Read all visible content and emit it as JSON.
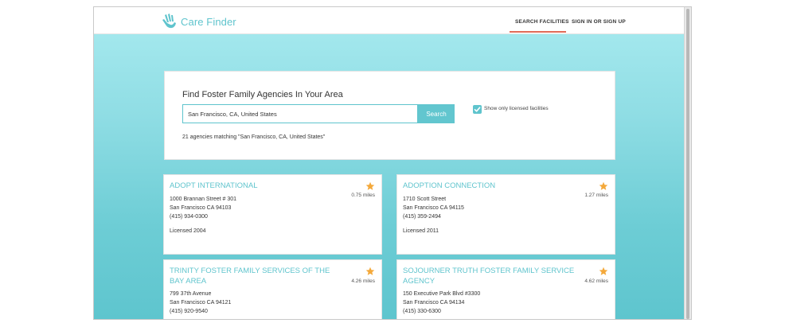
{
  "header": {
    "brand": "Care Finder",
    "nav": {
      "search_facilities": "SEARCH FACILITIES",
      "sign_in": "SIGN IN OR SIGN UP"
    }
  },
  "search": {
    "title": "Find Foster Family Agencies In Your Area",
    "input_value": "San Francisco, CA, United States",
    "button_label": "Search",
    "licensed_only_label": "Show only licensed facilities",
    "licensed_only_checked": true,
    "result_summary": "21 agencies matching \"San Francisco, CA, United States\""
  },
  "agencies": [
    {
      "name": "ADOPT INTERNATIONAL",
      "distance": "0.75 miles",
      "street": "1000 Brannan Street # 301",
      "city": "San Francisco CA 94103",
      "phone": "(415) 934-0300",
      "licensed": "Licensed 2004"
    },
    {
      "name": "ADOPTION CONNECTION",
      "distance": "1.27 miles",
      "street": "1710 Scott Street",
      "city": "San Francisco CA 94115",
      "phone": "(415) 359-2494",
      "licensed": "Licensed 2011"
    },
    {
      "name": "TRINITY FOSTER FAMILY SERVICES OF THE BAY AREA",
      "distance": "4.26 miles",
      "street": "799 37th Avenue",
      "city": "San Francisco CA 94121",
      "phone": "(415) 920-9540"
    },
    {
      "name": "SOJOURNER TRUTH FOSTER FAMILY SERVICE AGENCY",
      "distance": "4.62 miles",
      "street": "150 Executive Park Blvd #3300",
      "city": "San Francisco CA 94134",
      "phone": "(415) 330-6300"
    }
  ],
  "colors": {
    "accent": "#5fc4cd",
    "nav_underline": "#e26b58",
    "star": "#f4a93b"
  },
  "icons": {
    "logo": "hand-logo-icon",
    "favorite": "star-icon",
    "checkbox": "checkmark-icon"
  }
}
